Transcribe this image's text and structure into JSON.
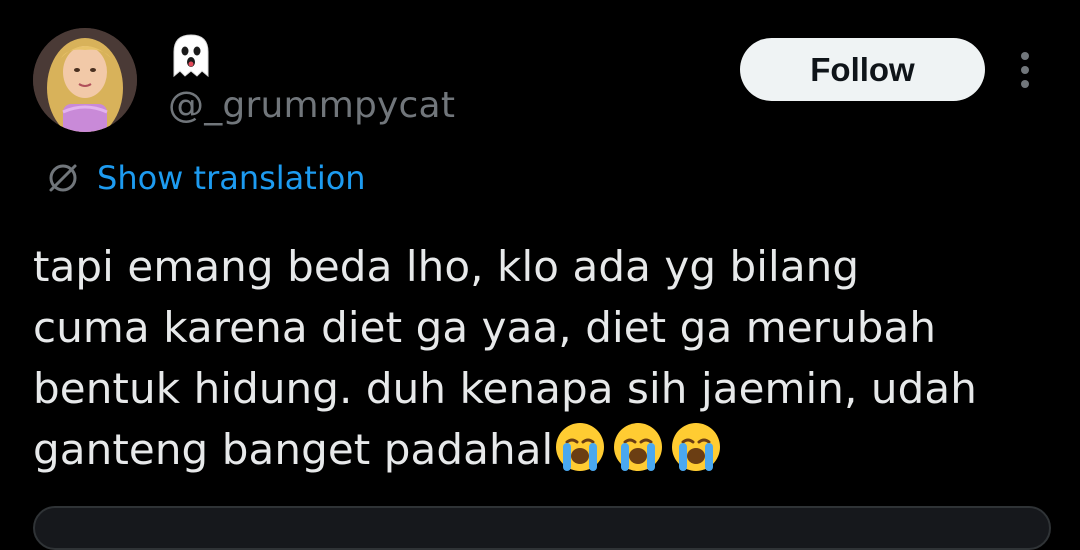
{
  "user": {
    "avatar": "profile-photo",
    "display_name_icon": "ghost-emoji",
    "handle": "@_grummpycat"
  },
  "actions": {
    "follow_label": "Follow",
    "more_icon": "vertical-ellipsis-icon"
  },
  "translation": {
    "icon": "translate-icon",
    "label": "Show translation"
  },
  "tweet": {
    "text": "tapi emang beda lho, klo ada yg bilang\ncuma karena diet ga yaa, diet ga merubah\nbentuk hidung. duh kenapa sih jaemin, udah\nganteng banget padahal",
    "trailing_emoji": "loudly-crying-face",
    "trailing_emoji_count": 3
  },
  "colors": {
    "background": "#000000",
    "text_primary": "#e7e9ea",
    "text_secondary": "#71767b",
    "accent": "#1d9bf0",
    "follow_button_bg": "#eff3f4",
    "follow_button_text": "#0f1419"
  }
}
